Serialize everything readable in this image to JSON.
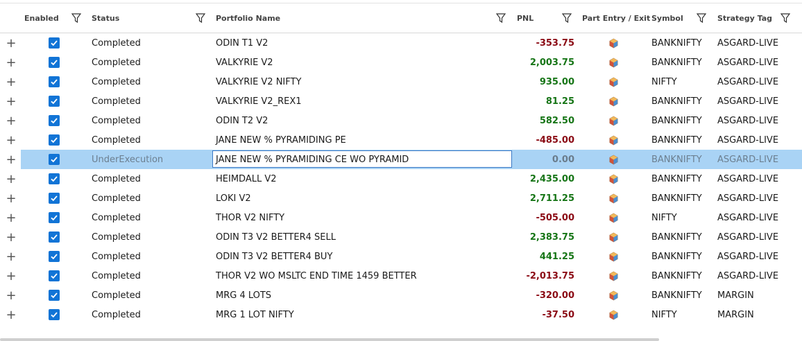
{
  "columns": {
    "enabled": "Enabled",
    "status": "Status",
    "portfolio_name": "Portfolio Name",
    "pnl": "PNL",
    "part_entry_exit": "Part Entry / Exit",
    "symbol": "Symbol",
    "strategy_tag": "Strategy Tag"
  },
  "icons": {
    "expander": "plus-icon",
    "filter": "filter-funnel-icon",
    "checkbox": "checkmark-icon",
    "part_entry": "hexagon-cube-icon"
  },
  "colors": {
    "checkbox": "#1174d6",
    "selected_row": "#a9d3f5",
    "pnl_negative": "#8b0a14",
    "pnl_positive": "#167516"
  },
  "expander_symbol": "+",
  "rows": [
    {
      "enabled": true,
      "status": "Completed",
      "name": "ODIN T1 V2",
      "pnl": "-353.75",
      "sign": "neg",
      "symbol": "BANKNIFTY",
      "tag": "ASGARD-LIVE"
    },
    {
      "enabled": true,
      "status": "Completed",
      "name": "VALKYRIE V2",
      "pnl": "2,003.75",
      "sign": "pos",
      "symbol": "BANKNIFTY",
      "tag": "ASGARD-LIVE"
    },
    {
      "enabled": true,
      "status": "Completed",
      "name": "VALKYRIE V2 NIFTY",
      "pnl": "935.00",
      "sign": "pos",
      "symbol": "NIFTY",
      "tag": "ASGARD-LIVE"
    },
    {
      "enabled": true,
      "status": "Completed",
      "name": "VALKYRIE V2_REX1",
      "pnl": "81.25",
      "sign": "pos",
      "symbol": "BANKNIFTY",
      "tag": "ASGARD-LIVE"
    },
    {
      "enabled": true,
      "status": "Completed",
      "name": "ODIN T2 V2",
      "pnl": "582.50",
      "sign": "pos",
      "symbol": "BANKNIFTY",
      "tag": "ASGARD-LIVE"
    },
    {
      "enabled": true,
      "status": "Completed",
      "name": "JANE NEW % PYRAMIDING PE",
      "pnl": "-485.00",
      "sign": "neg",
      "symbol": "BANKNIFTY",
      "tag": "ASGARD-LIVE"
    },
    {
      "enabled": true,
      "status": "UnderExecution",
      "name": "JANE NEW % PYRAMIDING CE WO PYRAMID",
      "pnl": "0.00",
      "sign": "zero",
      "symbol": "BANKNIFTY",
      "tag": "ASGARD-LIVE",
      "selected": true
    },
    {
      "enabled": true,
      "status": "Completed",
      "name": "HEIMDALL V2",
      "pnl": "2,435.00",
      "sign": "pos",
      "symbol": "BANKNIFTY",
      "tag": "ASGARD-LIVE"
    },
    {
      "enabled": true,
      "status": "Completed",
      "name": "LOKI V2",
      "pnl": "2,711.25",
      "sign": "pos",
      "symbol": "BANKNIFTY",
      "tag": "ASGARD-LIVE"
    },
    {
      "enabled": true,
      "status": "Completed",
      "name": "THOR V2 NIFTY",
      "pnl": "-505.00",
      "sign": "neg",
      "symbol": "NIFTY",
      "tag": "ASGARD-LIVE"
    },
    {
      "enabled": true,
      "status": "Completed",
      "name": "ODIN T3 V2 BETTER4 SELL",
      "pnl": "2,383.75",
      "sign": "pos",
      "symbol": "BANKNIFTY",
      "tag": "ASGARD-LIVE"
    },
    {
      "enabled": true,
      "status": "Completed",
      "name": "ODIN T3 V2 BETTER4 BUY",
      "pnl": "441.25",
      "sign": "pos",
      "symbol": "BANKNIFTY",
      "tag": "ASGARD-LIVE"
    },
    {
      "enabled": true,
      "status": "Completed",
      "name": "THOR V2 WO MSLTC END TIME 1459 BETTER",
      "pnl": "-2,013.75",
      "sign": "neg",
      "symbol": "BANKNIFTY",
      "tag": "ASGARD-LIVE"
    },
    {
      "enabled": true,
      "status": "Completed",
      "name": "MRG 4 LOTS",
      "pnl": "-320.00",
      "sign": "neg",
      "symbol": "BANKNIFTY",
      "tag": "MARGIN"
    },
    {
      "enabled": true,
      "status": "Completed",
      "name": "MRG 1 LOT NIFTY",
      "pnl": "-37.50",
      "sign": "neg",
      "symbol": "NIFTY",
      "tag": "MARGIN"
    }
  ]
}
